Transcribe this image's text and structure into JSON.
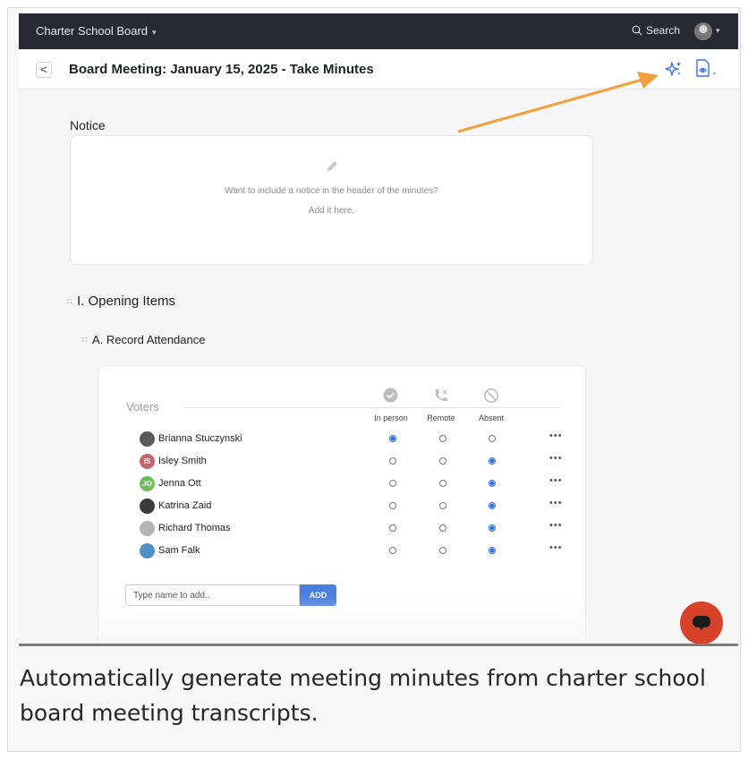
{
  "topbar": {
    "org_name": "Charter School Board",
    "org_caret": "▾",
    "search_label": "Search",
    "user_caret": "▾"
  },
  "header": {
    "back_label": "<",
    "title": "Board Meeting: January 15, 2025 - Take Minutes",
    "ai_icon": "sparkle-icon",
    "preview_icon": "preview-icon",
    "preview_caret": "⌄"
  },
  "notice": {
    "heading": "Notice",
    "prompt": "Want to include a notice in the header of the minutes?",
    "cta": "Add it here."
  },
  "agenda": {
    "section_title": "I. Opening Items",
    "item_title": "A. Record Attendance"
  },
  "attendance": {
    "voters_label": "Voters",
    "columns": [
      "In person",
      "Remote",
      "Absent"
    ],
    "rows": [
      {
        "name": "Brianna Stuczynski",
        "status": 0,
        "initials": "",
        "avatar_color": "#5a5a5a"
      },
      {
        "name": "Isley Smith",
        "status": 2,
        "initials": "IS",
        "avatar_color": "#c1666b"
      },
      {
        "name": "Jenna Ott",
        "status": 2,
        "initials": "JO",
        "avatar_color": "#6bbf59"
      },
      {
        "name": "Katrina Zaid",
        "status": 2,
        "initials": "",
        "avatar_color": "#3a3a3a"
      },
      {
        "name": "Richard Thomas",
        "status": 2,
        "initials": "",
        "avatar_color": "#b5b5b5"
      },
      {
        "name": "Sam Falk",
        "status": 2,
        "initials": "",
        "avatar_color": "#4f8fc7"
      }
    ],
    "more_label": "•••",
    "add_placeholder": "Type name to add..",
    "add_button": "ADD"
  },
  "caption": "Automatically generate meeting minutes from charter school board meeting transcripts.",
  "colors": {
    "topbar": "#272a33",
    "accent": "#2f6fe5",
    "annotation_arrow": "#f2a03d",
    "chat_button": "#d8412a"
  }
}
